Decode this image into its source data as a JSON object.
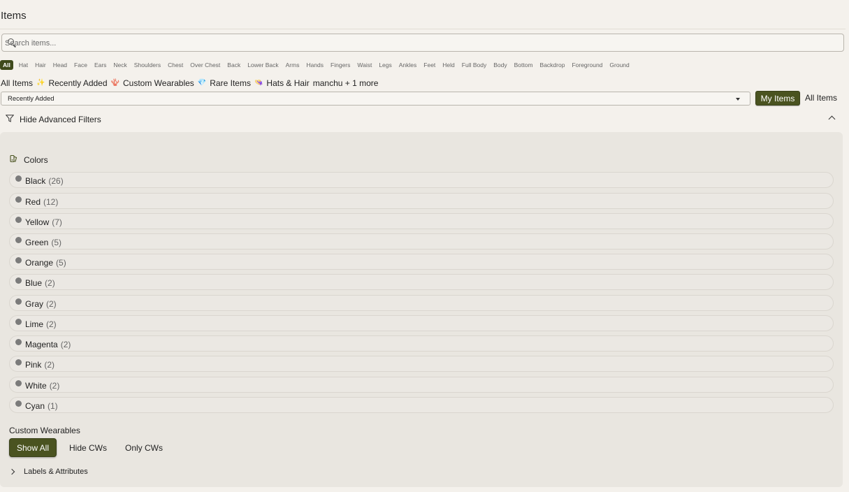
{
  "page": {
    "title": "Items"
  },
  "search": {
    "placeholder": "Search items..."
  },
  "categories": [
    "All",
    "Hat",
    "Hair",
    "Head",
    "Face",
    "Ears",
    "Neck",
    "Shoulders",
    "Chest",
    "Over Chest",
    "Back",
    "Lower Back",
    "Arms",
    "Hands",
    "Fingers",
    "Waist",
    "Legs",
    "Ankles",
    "Feet",
    "Held",
    "Full Body",
    "Body",
    "Bottom",
    "Backdrop",
    "Foreground",
    "Ground"
  ],
  "active_category": "All",
  "quick_filters": [
    {
      "label": "All Items",
      "emoji": "✨"
    },
    {
      "label": "Recently Added",
      "emoji": "🪸"
    },
    {
      "label": "Custom Wearables",
      "emoji": "💎"
    },
    {
      "label": "Rare Items",
      "emoji": "👒"
    },
    {
      "label": "Hats & Hair",
      "emoji": ""
    },
    {
      "label": "manchu + 1 more",
      "emoji": ""
    }
  ],
  "sort": {
    "selected": "Recently Added"
  },
  "toggle": {
    "my_items": "My Items",
    "all_items": "All Items"
  },
  "advanced": {
    "toggle_label": "Hide Advanced Filters"
  },
  "colors": {
    "heading": "Colors",
    "items": [
      {
        "name": "Black",
        "count": "(26)"
      },
      {
        "name": "Red",
        "count": "(12)"
      },
      {
        "name": "Yellow",
        "count": "(7)"
      },
      {
        "name": "Green",
        "count": "(5)"
      },
      {
        "name": "Orange",
        "count": "(5)"
      },
      {
        "name": "Blue",
        "count": "(2)"
      },
      {
        "name": "Gray",
        "count": "(2)"
      },
      {
        "name": "Lime",
        "count": "(2)"
      },
      {
        "name": "Magenta",
        "count": "(2)"
      },
      {
        "name": "Pink",
        "count": "(2)"
      },
      {
        "name": "White",
        "count": "(2)"
      },
      {
        "name": "Cyan",
        "count": "(1)"
      }
    ]
  },
  "custom_wearables": {
    "heading": "Custom Wearables",
    "show_all": "Show All",
    "hide": "Hide CWs",
    "only": "Only CWs"
  },
  "labels_attributes": {
    "label": "Labels & Attributes"
  },
  "theme": {
    "accent": "#4a5320",
    "background": "#f4f1ec",
    "panel": "#e9e6e0"
  }
}
